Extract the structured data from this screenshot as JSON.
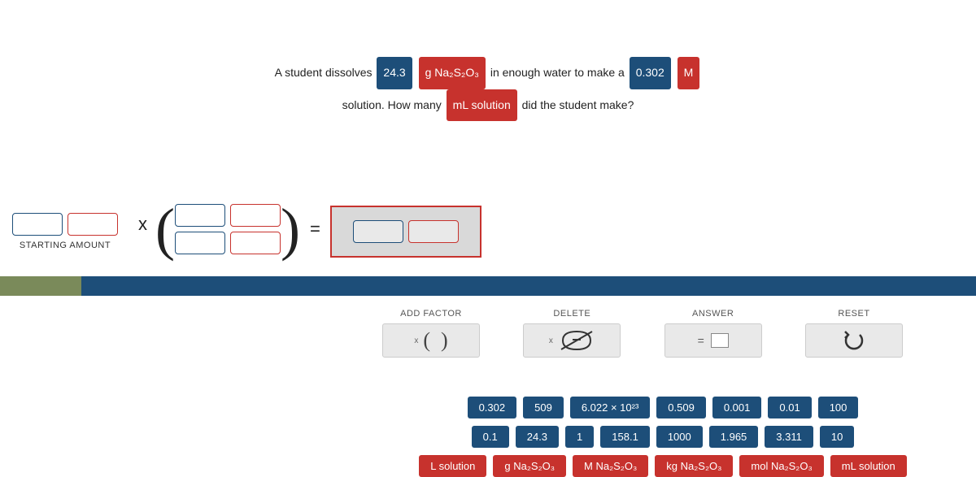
{
  "question": {
    "p1": "A student dissolves",
    "amount": "24.3",
    "mass_unit": "g Na₂S₂O₃",
    "p2": "in enough water to make a",
    "molarity": "0.302",
    "molarity_unit": "M",
    "p3": "solution. How many",
    "target": "mL solution",
    "p4": "did the student make?"
  },
  "equation": {
    "starting_label": "STARTING AMOUNT",
    "times": "x",
    "equals": "="
  },
  "tools": {
    "add_factor": "ADD FACTOR",
    "delete": "DELETE",
    "answer": "ANSWER",
    "reset": "RESET"
  },
  "tiles_row1": [
    "0.302",
    "509",
    "6.022 × 10²³",
    "0.509",
    "0.001",
    "0.01",
    "100"
  ],
  "tiles_row2": [
    "0.1",
    "24.3",
    "1",
    "158.1",
    "1000",
    "1.965",
    "3.311",
    "10"
  ],
  "tiles_row3": [
    "L solution",
    "g Na₂S₂O₃",
    "M Na₂S₂O₃",
    "kg Na₂S₂O₃",
    "mol Na₂S₂O₃",
    "mL solution"
  ],
  "chart_data": null
}
